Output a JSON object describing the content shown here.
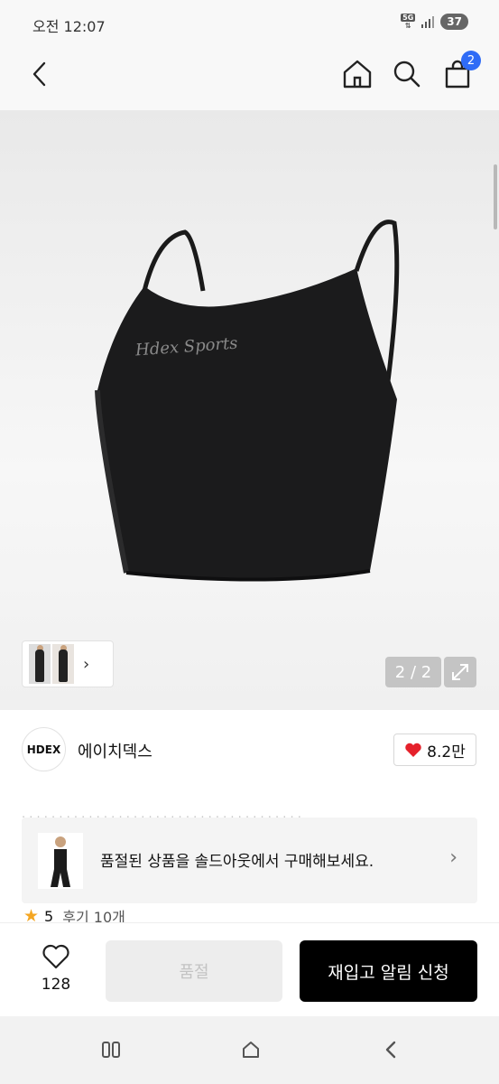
{
  "status_bar": {
    "time": "오전 12:07",
    "network": "5G",
    "battery": "37"
  },
  "top_nav": {
    "cart_count": "2"
  },
  "product_image": {
    "print_text": "Hdex Sports"
  },
  "gallery": {
    "page_indicator": "2 / 2"
  },
  "brand": {
    "logo_text": "HDEX",
    "name": "에이치덱스",
    "like_count": "8.2만"
  },
  "soldout_banner": {
    "text": "품절된 상품을 솔드아웃에서 구매해보세요."
  },
  "rating": {
    "score": "5",
    "review_label": "후기 10개"
  },
  "action_bar": {
    "wish_count": "128",
    "soldout_label": "품절",
    "restock_label": "재입고 알림 신청"
  },
  "colors": {
    "accent_blue": "#2f6cf6",
    "heart_red": "#e5212b",
    "star": "#f4a623",
    "primary_button": "#000000"
  }
}
